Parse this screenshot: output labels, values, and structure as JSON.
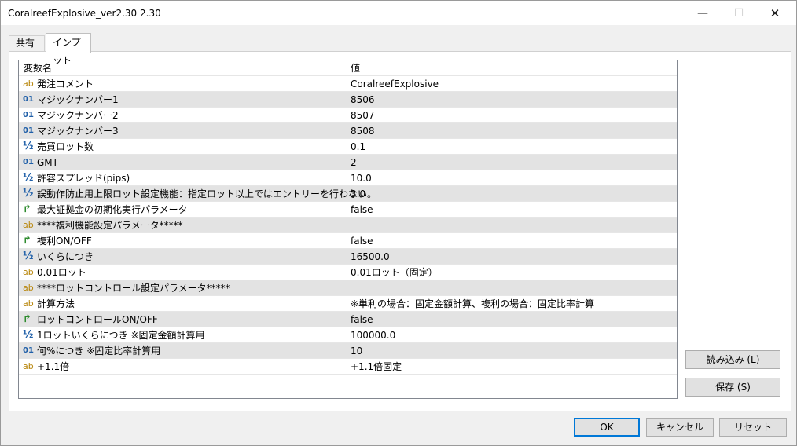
{
  "window": {
    "title": "CoralreefExplosive_ver2.30 2.30",
    "min_symbol": "—",
    "max_symbol": "☐",
    "close_symbol": "✕"
  },
  "tabs": [
    {
      "label": "共有"
    },
    {
      "label": "インプット"
    }
  ],
  "grid": {
    "headers": {
      "name": "変数名",
      "value": "値"
    },
    "rows": [
      {
        "icon": "ab",
        "name": "発注コメント",
        "value": "CoralreefExplosive"
      },
      {
        "icon": "01",
        "name": "マジックナンバー1",
        "value": "8506"
      },
      {
        "icon": "01",
        "name": "マジックナンバー2",
        "value": "8507"
      },
      {
        "icon": "01",
        "name": "マジックナンバー3",
        "value": "8508"
      },
      {
        "icon": "½",
        "name": "売買ロット数",
        "value": "0.1"
      },
      {
        "icon": "01",
        "name": "GMT",
        "value": "2"
      },
      {
        "icon": "½",
        "name": "許容スプレッド(pips)",
        "value": "10.0"
      },
      {
        "icon": "½",
        "name": "誤動作防止用上限ロット設定機能：指定ロット以上ではエントリーを行わない。",
        "value": "3.0"
      },
      {
        "icon": "↱",
        "name": "最大証拠金の初期化実行パラメータ",
        "value": "false"
      },
      {
        "icon": "ab",
        "name": "****複利機能設定パラメータ*****",
        "value": ""
      },
      {
        "icon": "↱",
        "name": "複利ON/OFF",
        "value": "false"
      },
      {
        "icon": "½",
        "name": "いくらにつき",
        "value": "16500.0"
      },
      {
        "icon": "ab",
        "name": "0.01ロット",
        "value": "0.01ロット（固定）"
      },
      {
        "icon": "ab",
        "name": "****ロットコントロール設定パラメータ*****",
        "value": ""
      },
      {
        "icon": "ab",
        "name": "計算方法",
        "value": "※単利の場合：固定金額計算、複利の場合：固定比率計算"
      },
      {
        "icon": "↱",
        "name": "ロットコントロールON/OFF",
        "value": "false"
      },
      {
        "icon": "½",
        "name": "1ロットいくらにつき ※固定金額計算用",
        "value": "100000.0"
      },
      {
        "icon": "01",
        "name": "何%につき ※固定比率計算用",
        "value": "10"
      },
      {
        "icon": "ab",
        "name": "+1.1倍",
        "value": "+1.1倍固定"
      }
    ]
  },
  "side_buttons": {
    "load": "読み込み (L)",
    "save": "保存 (S)"
  },
  "footer_buttons": {
    "ok": "OK",
    "cancel": "キャンセル",
    "reset": "リセット"
  }
}
